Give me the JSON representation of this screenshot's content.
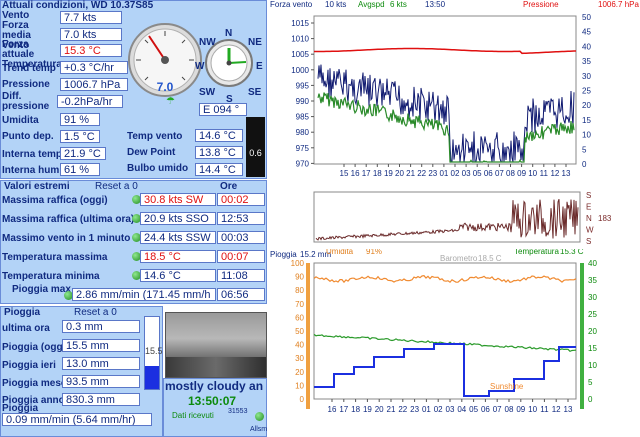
{
  "current": {
    "header": "Attuali condizioni, WD 10.37S85",
    "wind_label": "Vento",
    "wind_value": "7.7 kts",
    "wind_avg_label": "Forza media Vento",
    "wind_avg_value": "7.0 kts",
    "wind_now_label": "Forza attuale Temperatura",
    "temp_value": "15.3 °C",
    "temp_trend_label": "Trend temp",
    "temp_trend_value": "+0.3 °C/hr",
    "pressure_label": "Pressione",
    "pressure_value": "1006.7 hPa",
    "pressure_diff_label": "Diff. pressione",
    "pressure_diff_value": "-0.2hPa/hr",
    "humidity_label": "Umidita",
    "humidity_value": "91 %",
    "dewpoint_label": "Punto dep.",
    "dewpoint_value": "1.5 °C",
    "indoor_temp_label": "Interna temp.",
    "indoor_temp_value": "21.9 °C",
    "indoor_hum_label": "Interna hum",
    "indoor_hum_value": "61 %",
    "windchill_label": "Temp vento",
    "windchill_value": "14.6 °C",
    "dew_label": "Dew Point",
    "dew_value": "13.8 °C",
    "wetbulb_label": "Bulbo umido",
    "wetbulb_value": "14.4 °C",
    "gauge_value": "7.0",
    "direction_value": "E  094 °",
    "compass": {
      "n": "N",
      "ne": "NE",
      "nw": "NW",
      "e": "E",
      "w": "W",
      "sw": "SW",
      "se": "SE",
      "s": "S"
    },
    "bar_value": "0.6"
  },
  "extremes": {
    "header": "Valori estremi",
    "reset_label": "Reset a 0",
    "time_header": "Ore",
    "rows": [
      {
        "label": "Massima raffica (oggi)",
        "value": "30.8 kts  SW",
        "time": "00:02",
        "red": true
      },
      {
        "label": "Massima raffica (ultima ora)",
        "value": "20.9 kts SSO",
        "time": "12:53",
        "red": false
      },
      {
        "label": "Massimo vento in 1 minuto",
        "value": "24.4 kts SSW",
        "time": "00:03",
        "red": false
      },
      {
        "label": "Temperatura massima",
        "value": "18.5 °C",
        "time": "00:07",
        "red": true
      },
      {
        "label": "Temperatura minima",
        "value": "14.6 °C",
        "time": "11:08",
        "red": false
      }
    ],
    "rain_max_label": "Pioggia max",
    "rain_max_value": "2.86 mm/min (171.45 mm/h",
    "rain_max_time": "06:56"
  },
  "rain": {
    "header": "Pioggia",
    "reset_label": "Reset a 0",
    "rows": [
      {
        "label": "ultima ora",
        "value": "0.3 mm"
      },
      {
        "label": "Pioggia (oggi)",
        "value": "15.5 mm"
      },
      {
        "label": "Pioggia ieri",
        "value": "13.0 mm"
      },
      {
        "label": "Pioggia mese",
        "value": "93.5 mm"
      },
      {
        "label": "Pioggia anno",
        "value": "830.3 mm"
      }
    ],
    "rate_label": "Pioggia",
    "rate_value": "0.09 mm/min (5.64 mm/hr)",
    "gauge_label": "15.5",
    "gauge_fill": 0.31
  },
  "status": {
    "condition": "mostly cloudy an",
    "time": "13:50:07",
    "data_label": "Dati ricevuti",
    "count": "31553",
    "alarm_label": "Allsm"
  },
  "chart_top": {
    "legend": {
      "wind": "Forza vento",
      "wind_val": "10 kts",
      "avg": "Avgspd",
      "avg_val": "6 kts",
      "time": "13:50",
      "pressure": "Pressione",
      "pressure_val": "1006.7 hPa"
    },
    "left_ticks": [
      "1015",
      "1010",
      "1005",
      "1000",
      "995",
      "990",
      "985",
      "980",
      "975",
      "970"
    ],
    "right_ticks": [
      "50",
      "45",
      "40",
      "35",
      "30",
      "25",
      "20",
      "15",
      "10",
      "5",
      "0"
    ],
    "x_ticks": [
      "15",
      "16",
      "17",
      "18",
      "19",
      "20",
      "21",
      "22",
      "23",
      "01",
      "02",
      "03",
      "05",
      "06",
      "07",
      "08",
      "09",
      "10",
      "11",
      "12",
      "13"
    ]
  },
  "chart_dir": {
    "labels": [
      "S",
      "E",
      "N",
      "W",
      "S"
    ],
    "value": "183"
  },
  "chart_bottom": {
    "rain_label": "Pioggia",
    "rain_val": "15.2 mm",
    "humidity_label": "Umidita",
    "humidity_val": "91%",
    "barometer_label": "Barometro",
    "barometer_val": "18.5 C",
    "temp_label": "Temperatura",
    "temp_val": "15.3 C",
    "sunshine_label": "Sunshine",
    "left_ticks": [
      "100",
      "90",
      "80",
      "70",
      "60",
      "50",
      "40",
      "30",
      "20",
      "10",
      "0"
    ],
    "right_ticks": [
      "40",
      "35",
      "30",
      "25",
      "20",
      "15",
      "10",
      "5",
      "0"
    ],
    "x_ticks": [
      "16",
      "17",
      "18",
      "19",
      "20",
      "21",
      "22",
      "23",
      "01",
      "02",
      "03",
      "04",
      "05",
      "06",
      "07",
      "08",
      "09",
      "10",
      "11",
      "12",
      "13"
    ]
  },
  "colors": {
    "panel": "#b3d3f7",
    "label": "#102a80",
    "accent_red": "#e01010",
    "rain_fill": "#1b2fe0"
  }
}
